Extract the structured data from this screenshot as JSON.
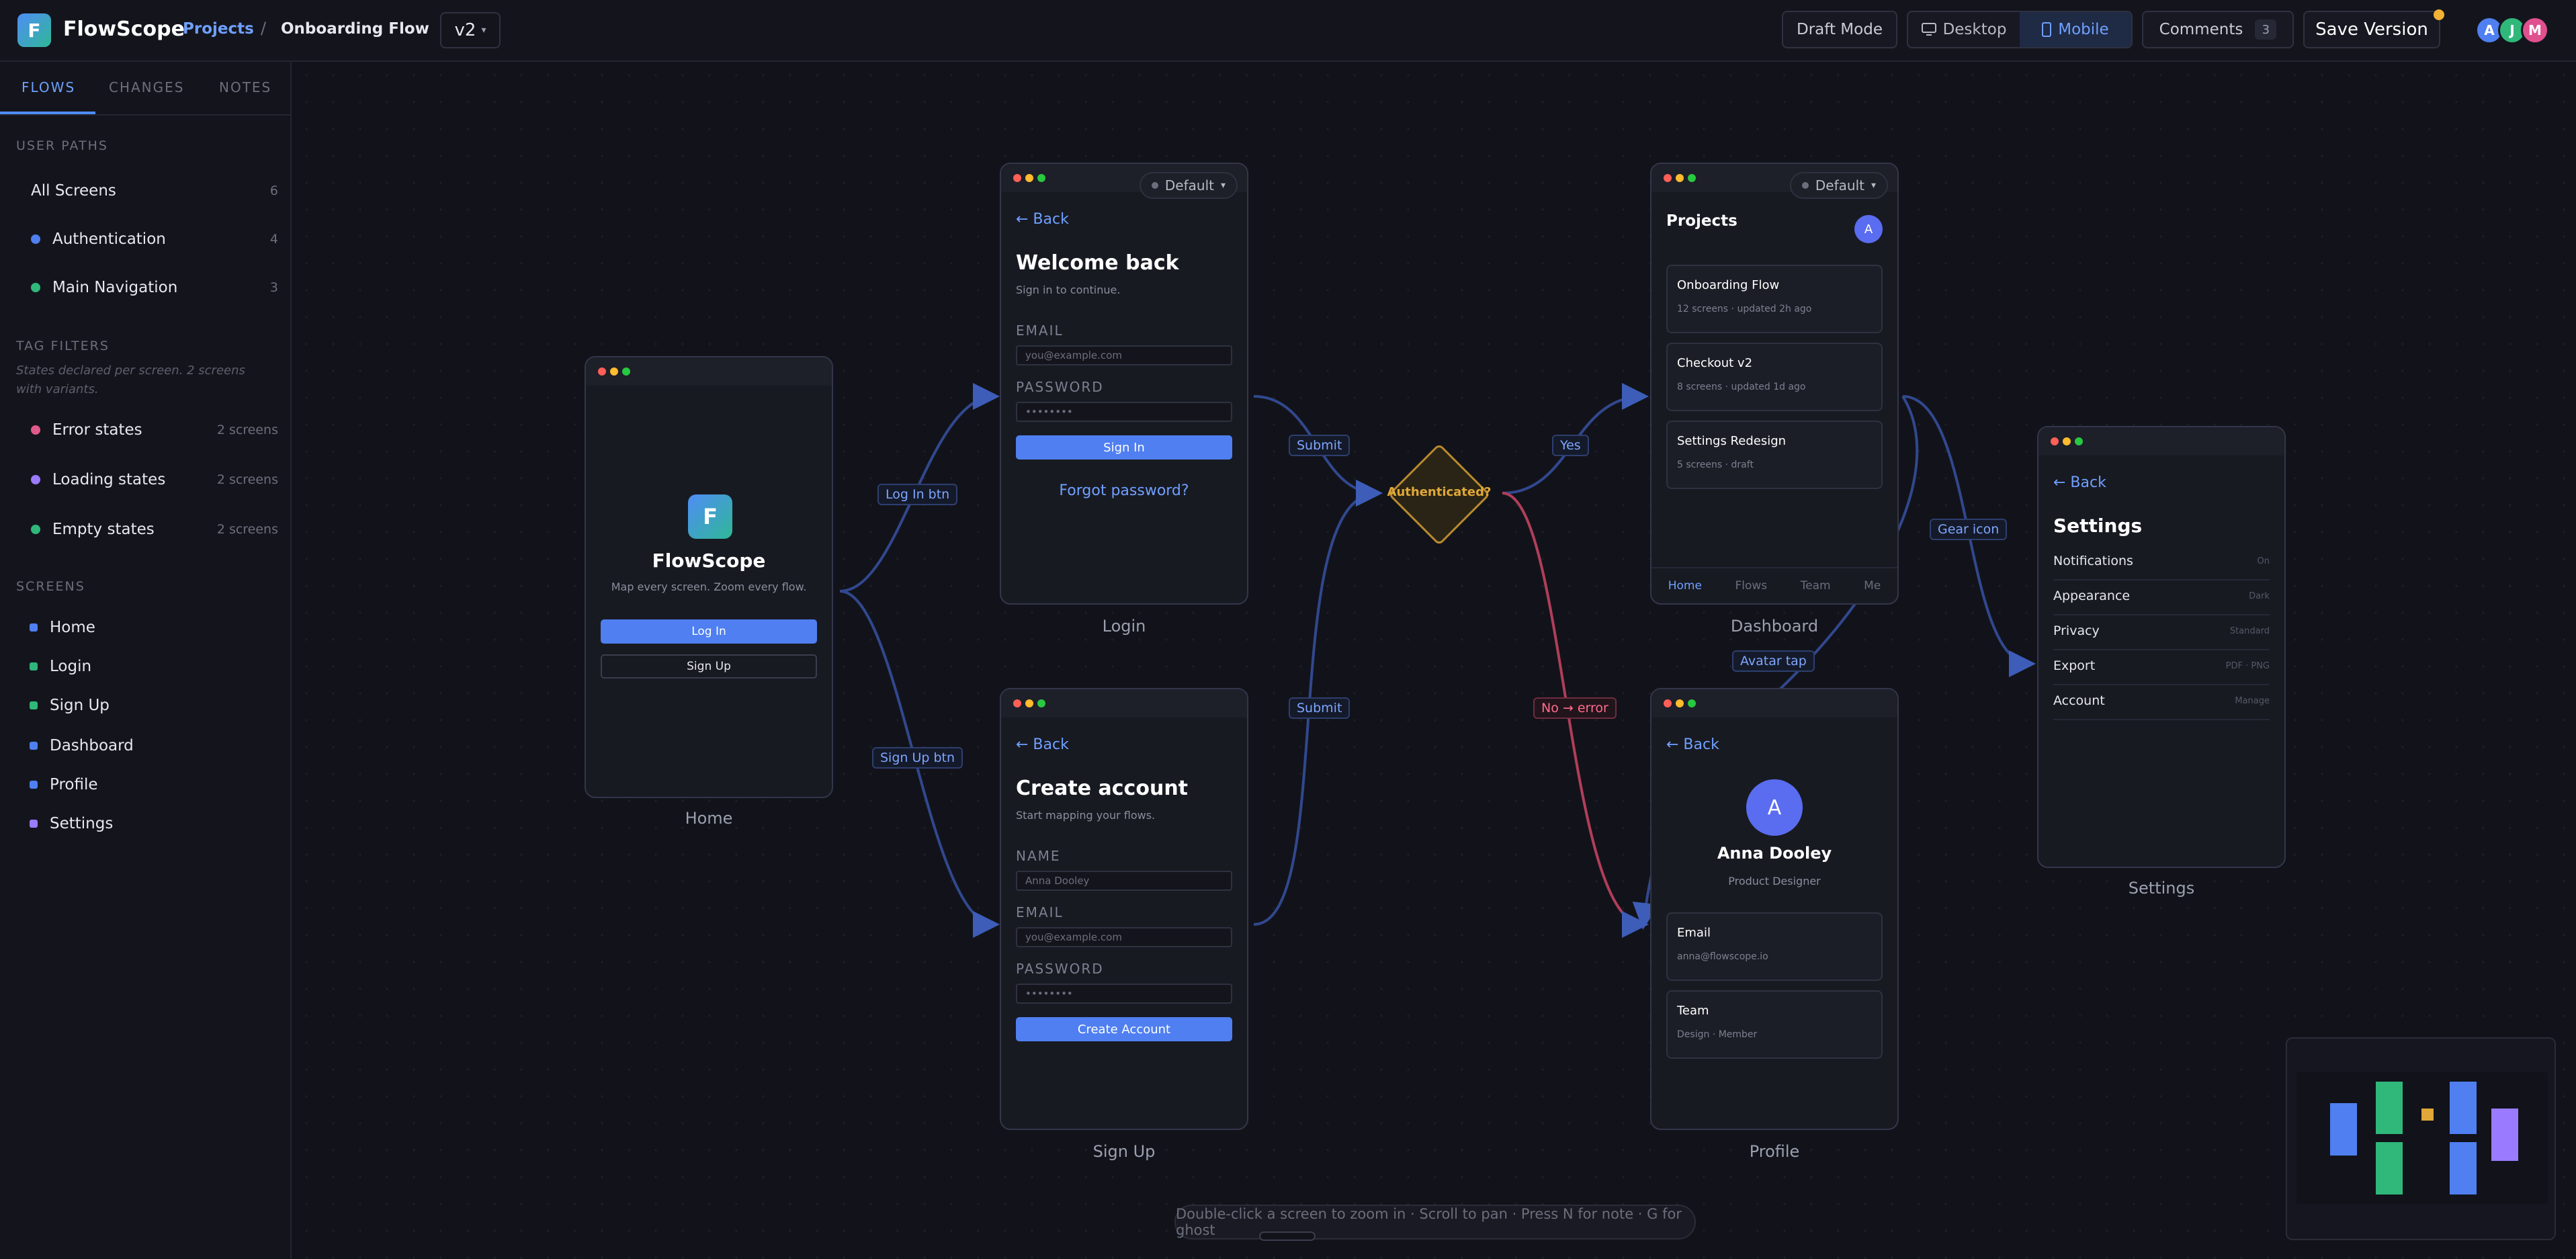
{
  "topbar": {
    "logo_letter": "F",
    "app_name": "FlowScope",
    "breadcrumb_projects": "Projects",
    "breadcrumb_sep": "/",
    "breadcrumb_current": "Onboarding Flow",
    "version": "v2",
    "draft_mode": "Draft Mode",
    "device_desktop": "Desktop",
    "device_mobile": "Mobile",
    "comments_label": "Comments",
    "comments_count": "3",
    "save_version": "Save Version",
    "collaborators": [
      {
        "initial": "A",
        "color": "#4f7ff0"
      },
      {
        "initial": "J",
        "color": "#2fb87a"
      },
      {
        "initial": "M",
        "color": "#e0508f"
      }
    ]
  },
  "sidebar": {
    "tabs": [
      "FLOWS",
      "CHANGES",
      "NOTES"
    ],
    "user_paths_title": "USER PATHS",
    "user_paths": [
      {
        "label": "All Screens",
        "count": "6"
      },
      {
        "label": "Authentication",
        "count": "4",
        "color": "#4f7ff0"
      },
      {
        "label": "Main Navigation",
        "count": "3",
        "color": "#2fb87a"
      }
    ],
    "tag_filters_title": "TAG FILTERS",
    "tag_filters_note": "States declared per screen. 2 screens with variants.",
    "tag_filters": [
      {
        "label": "Error states",
        "count": "2 screens",
        "color": "#e05a8a"
      },
      {
        "label": "Loading states",
        "count": "2 screens",
        "color": "#9a7bff"
      },
      {
        "label": "Empty states",
        "count": "2 screens",
        "color": "#2fb87a"
      }
    ],
    "screens_title": "SCREENS",
    "screens": [
      {
        "label": "Home",
        "color": "#4f7ff0"
      },
      {
        "label": "Login",
        "color": "#2fb87a"
      },
      {
        "label": "Sign Up",
        "color": "#2fb87a"
      },
      {
        "label": "Dashboard",
        "color": "#4f7ff0"
      },
      {
        "label": "Profile",
        "color": "#4f7ff0"
      },
      {
        "label": "Settings",
        "color": "#9a7bff"
      }
    ]
  },
  "screens": {
    "home": {
      "label": "Home",
      "logo_letter": "F",
      "title": "FlowScope",
      "tagline": "Map every screen. Zoom every flow.",
      "login_btn": "Log In",
      "signup_btn": "Sign Up"
    },
    "login": {
      "label": "Login",
      "state": "Default",
      "back": "← Back",
      "title": "Welcome back",
      "subtitle": "Sign in to continue.",
      "email_label": "EMAIL",
      "email_placeholder": "you@example.com",
      "password_label": "PASSWORD",
      "password_value": "••••••••",
      "submit": "Sign In",
      "forgot": "Forgot password?"
    },
    "signup": {
      "label": "Sign Up",
      "back": "← Back",
      "title": "Create account",
      "subtitle": "Start mapping your flows.",
      "name_label": "NAME",
      "name_placeholder": "Anna Dooley",
      "email_label": "EMAIL",
      "email_placeholder": "you@example.com",
      "password_label": "PASSWORD",
      "password_value": "••••••••",
      "submit": "Create Account"
    },
    "dashboard": {
      "label": "Dashboard",
      "state": "Default",
      "title": "Projects",
      "avatar": "A",
      "projects": [
        {
          "name": "Onboarding Flow",
          "meta": "12 screens · updated 2h ago"
        },
        {
          "name": "Checkout v2",
          "meta": "8 screens · updated 1d ago"
        },
        {
          "name": "Settings Redesign",
          "meta": "5 screens · draft"
        }
      ],
      "nav": [
        "Home",
        "Flows",
        "Team",
        "Me"
      ]
    },
    "profile": {
      "label": "Profile",
      "back": "← Back",
      "avatar": "A",
      "name": "Anna Dooley",
      "role": "Product Designer",
      "cards": [
        {
          "title": "Email",
          "value": "anna@flowscope.io"
        },
        {
          "title": "Team",
          "value": "Design · Member"
        }
      ]
    },
    "settings": {
      "label": "Settings",
      "back": "← Back",
      "title": "Settings",
      "rows": [
        {
          "k": "Notifications",
          "v": "On"
        },
        {
          "k": "Appearance",
          "v": "Dark"
        },
        {
          "k": "Privacy",
          "v": "Standard"
        },
        {
          "k": "Export",
          "v": "PDF · PNG"
        },
        {
          "k": "Account",
          "v": "Manage"
        }
      ]
    }
  },
  "decision": {
    "label": "Authenticated?"
  },
  "edges": {
    "login_btn": "Log In btn",
    "signup_btn": "Sign Up btn",
    "submit_login": "Submit",
    "submit_signup": "Submit",
    "yes": "Yes",
    "no_error": "No → error",
    "gear_icon": "Gear icon",
    "avatar_tap": "Avatar tap"
  },
  "hint": "Double-click a screen to zoom in · Scroll to pan · Press N for note · G for ghost",
  "colors": {
    "accent": "#4f7ff0",
    "decision": "#e0a838",
    "error_edge": "#c2455e"
  }
}
